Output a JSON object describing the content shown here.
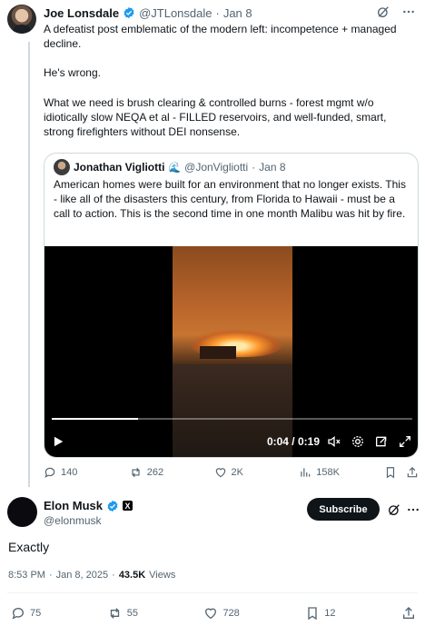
{
  "parent_tweet": {
    "author_name": "Joe Lonsdale",
    "handle": "@JTLonsdale",
    "separator": "·",
    "date": "Jan 8",
    "paragraphs": [
      "A defeatist post emblematic of the modern left: incompetence + managed decline.",
      "He's wrong.",
      "What we need is brush clearing & controlled burns - forest mgmt w/o idiotically slow NEQA et al - FILLED reservoirs, and well-funded, smart, strong firefighters without DEI nonsense."
    ],
    "quote": {
      "author_name": "Jonathan Vigliotti",
      "emoji": "🌊",
      "handle": "@JonVigliotti",
      "separator": "·",
      "date": "Jan 8",
      "text": "American homes were built for an environment that no longer exists. This - like all of the disasters this century, from Florida to Hawaii - must be a call to action. This is the second time in one month Malibu was hit by fire.",
      "video": {
        "current_time": "0:04",
        "duration": "0:19",
        "time_display": "0:04 / 0:19",
        "progress_fraction": 0.24
      }
    },
    "actions": {
      "replies": "140",
      "reposts": "262",
      "likes": "2K",
      "views": "158K"
    }
  },
  "main_tweet": {
    "author_name": "Elon Musk",
    "handle": "@elonmusk",
    "subscribe_label": "Subscribe",
    "x_badge": "X",
    "text": "Exactly",
    "time": "8:53 PM",
    "separator": "·",
    "date": "Jan 8, 2025",
    "separator2": "·",
    "views_count": "43.5K",
    "views_label": "Views",
    "actions": {
      "replies": "75",
      "reposts": "55",
      "likes": "728",
      "bookmarks": "12"
    }
  },
  "colors": {
    "text": "#0f1419",
    "muted": "#536471",
    "verified": "#1d9bf0",
    "border": "#cfd9de"
  }
}
